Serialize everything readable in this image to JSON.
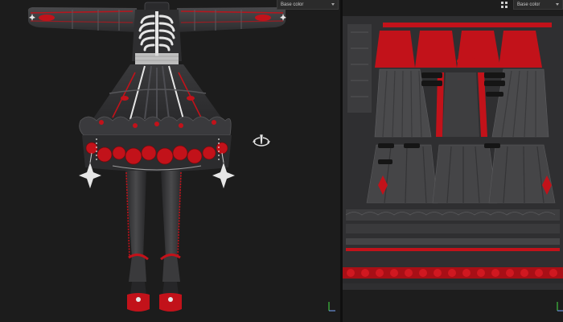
{
  "viewport_3d": {
    "channel_label": "Base color"
  },
  "viewport_2d": {
    "channel_label": "Base color"
  },
  "colors": {
    "background": "#1c1c1c",
    "cloth_dark": "#3b3b3d",
    "accent_red": "#c2121a",
    "bone_white": "#e6e6e6"
  },
  "icons": {
    "rotate_cursor": "rotate-cursor-icon",
    "axis": "axis-gizmo-icon",
    "uv_tool": "uv-grid-icon"
  }
}
